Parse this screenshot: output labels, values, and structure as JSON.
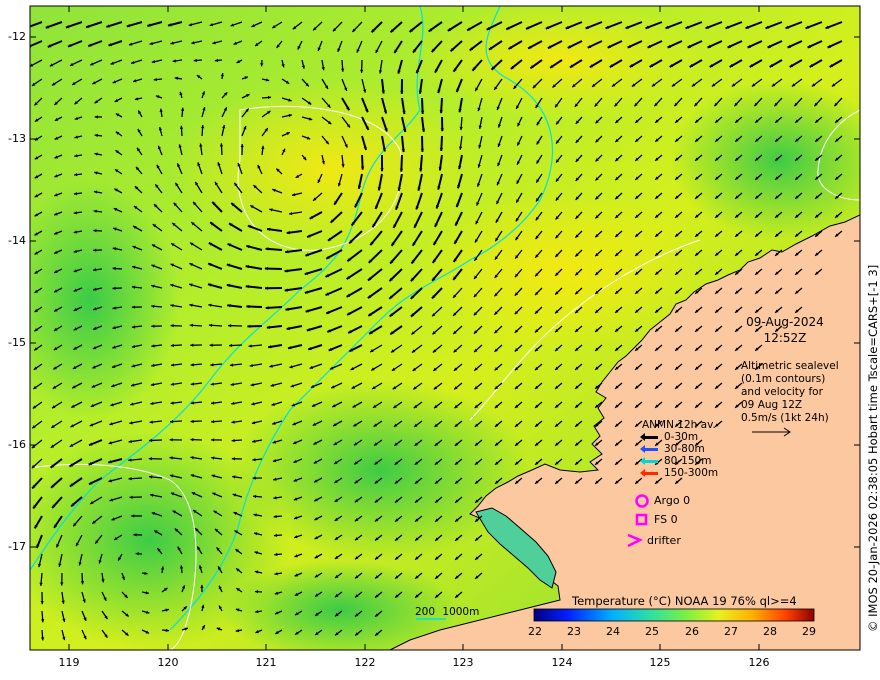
{
  "map": {
    "lat_ticks": [
      "-12",
      "-13",
      "-14",
      "-15",
      "-16",
      "-17"
    ],
    "lon_ticks": [
      "119",
      "120",
      "121",
      "122",
      "123",
      "124",
      "125",
      "126"
    ],
    "extent": {
      "lon_min": 118.6,
      "lon_max": 126.95,
      "lat_min": -17.95,
      "lat_max": -11.75
    }
  },
  "date": {
    "line1": "09-Aug-2024",
    "line2": "12:52Z"
  },
  "altimetry": {
    "lines": [
      "Altimetric sealevel",
      "(0.1m contours)",
      "and velocity for",
      "09 Aug 12Z",
      "0.5m/s (1kt 24h)"
    ]
  },
  "anmn": {
    "title": "ANMN 12h av.",
    "depths": [
      {
        "label": "0-30m",
        "color": "#000000"
      },
      {
        "label": "30-80m",
        "color": "#1f4fff"
      },
      {
        "label": "80-150m",
        "color": "#00d8d8"
      },
      {
        "label": "150-300m",
        "color": "#ff2a00"
      }
    ]
  },
  "platforms": {
    "argo": "Argo 0",
    "fs": "FS 0",
    "drifter": "drifter",
    "marker_color": "#ff00ff"
  },
  "colorbar": {
    "title": "Temperature (°C) NOAA 19 76% ql>=4",
    "ticks": [
      "22",
      "23",
      "24",
      "25",
      "26",
      "27",
      "28",
      "29"
    ]
  },
  "contour_key": {
    "label_200": "200",
    "label_1000": "1000m",
    "color": "#00e0e0"
  },
  "credit": "© IMOS 20-Jan-2026 02:38:05 Hobart time Tscale=CARS+[-1 3]",
  "colors": {
    "land": "#fbc8a0",
    "coast": "#000000",
    "bathy": "#00e0e0",
    "ssh_contour": "#ffffff"
  }
}
